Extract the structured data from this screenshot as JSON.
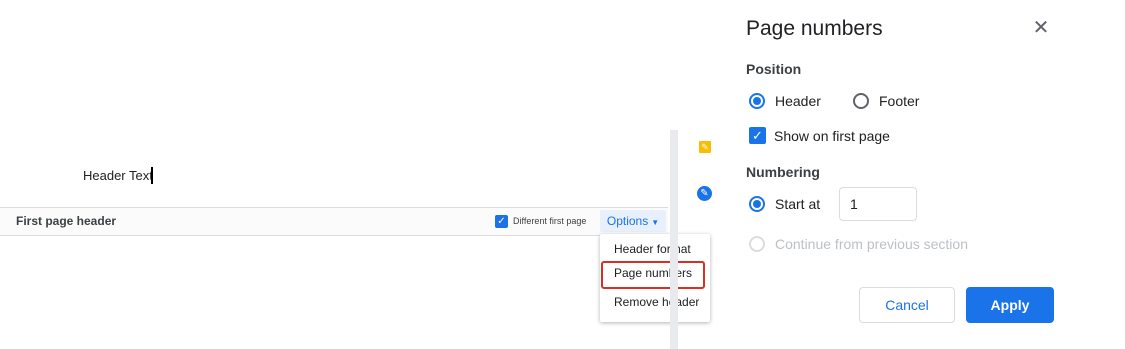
{
  "document": {
    "header_text": "Header Text",
    "header_bar": {
      "label": "First page header",
      "different_first_page_label": "Different first page",
      "different_first_page_checked": true,
      "options_label": "Options"
    },
    "options_menu": {
      "items": [
        "Header format",
        "Page numbers",
        "Remove header"
      ],
      "highlighted": "Page numbers"
    }
  },
  "side_icons": [
    "note-icon",
    "edit-pencil-icon"
  ],
  "dialog": {
    "title": "Page numbers",
    "position_label": "Position",
    "position_options": [
      "Header",
      "Footer"
    ],
    "position_selected": "Header",
    "show_on_first_page_label": "Show on first page",
    "show_on_first_page_checked": true,
    "numbering_label": "Numbering",
    "start_at_label": "Start at",
    "start_at_value": "1",
    "continue_label": "Continue from previous section",
    "cancel_label": "Cancel",
    "apply_label": "Apply"
  },
  "colors": {
    "accent": "#1a73e8",
    "highlight_border": "#d93025",
    "note_icon": "#fbbc04"
  }
}
